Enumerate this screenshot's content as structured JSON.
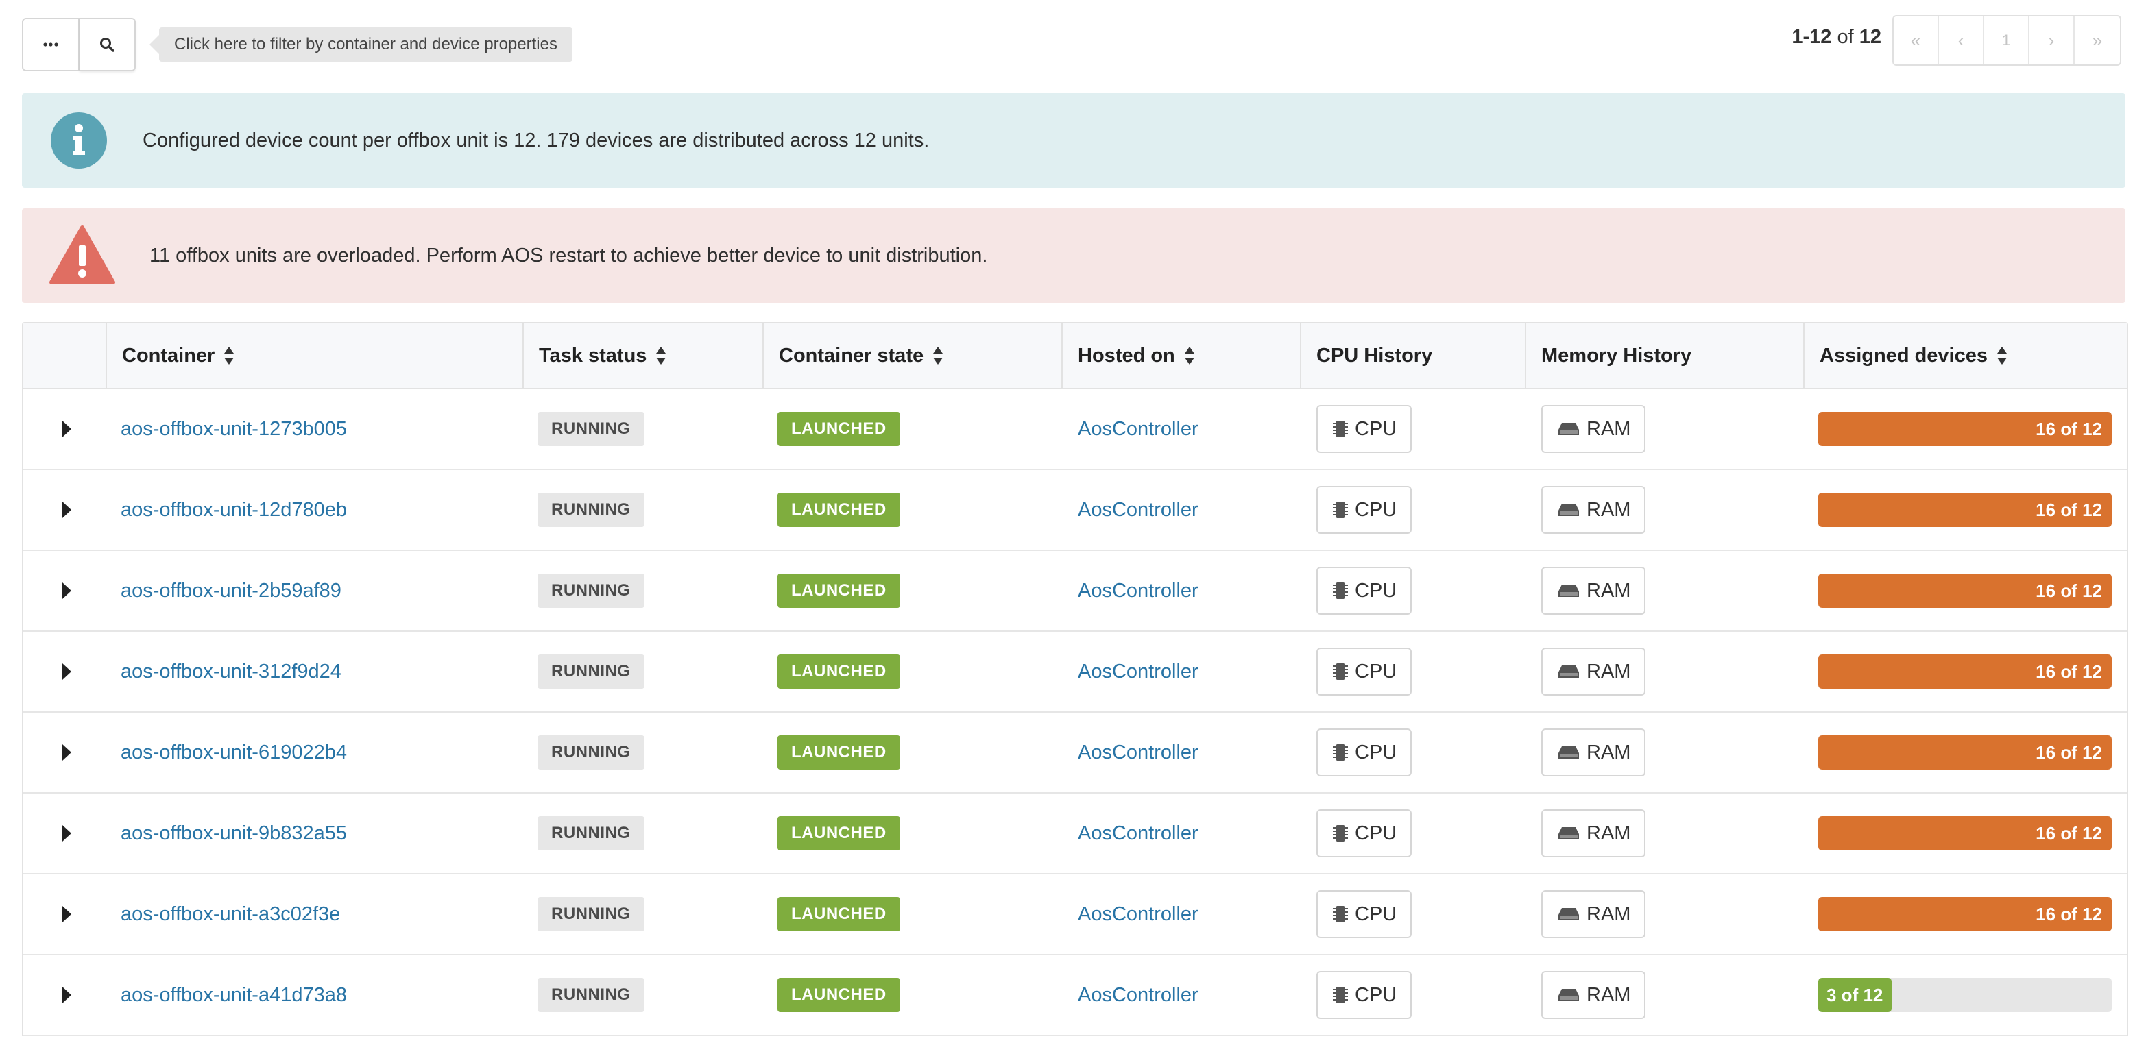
{
  "toolbar": {
    "more_icon": "ellipsis-icon",
    "search_icon": "search-icon",
    "filter_hint": "Click here to filter by container and device properties"
  },
  "pagination": {
    "range": "1-12",
    "of_label": "of",
    "total": "12",
    "current_page": "1",
    "first_glyph": "«",
    "prev_glyph": "‹",
    "next_glyph": "›",
    "last_glyph": "»"
  },
  "alerts": {
    "info": "Configured device count per offbox unit is 12. 179 devices are distributed across 12 units.",
    "warning": "11 offbox units are overloaded. Perform AOS restart to achieve better device to unit distribution."
  },
  "colors": {
    "info_bg": "#e0eff1",
    "info_icon": "#5ba4b5",
    "warning_bg": "#f6e6e5",
    "warning_icon": "#e06e62",
    "overloaded": "#d9722e",
    "normal": "#7fad3e",
    "link": "#2874a6"
  },
  "table": {
    "columns": {
      "container": "Container",
      "task_status": "Task status",
      "container_state": "Container state",
      "hosted_on": "Hosted on",
      "cpu_history": "CPU History",
      "memory_history": "Memory History",
      "assigned_devices": "Assigned devices"
    },
    "cpu_label": "CPU",
    "ram_label": "RAM",
    "rows": [
      {
        "container": "aos-offbox-unit-1273b005",
        "task_status": "RUNNING",
        "container_state": "LAUNCHED",
        "hosted_on": "AosController",
        "assigned": "16 of 12",
        "assigned_value": 16,
        "capacity": 12
      },
      {
        "container": "aos-offbox-unit-12d780eb",
        "task_status": "RUNNING",
        "container_state": "LAUNCHED",
        "hosted_on": "AosController",
        "assigned": "16 of 12",
        "assigned_value": 16,
        "capacity": 12
      },
      {
        "container": "aos-offbox-unit-2b59af89",
        "task_status": "RUNNING",
        "container_state": "LAUNCHED",
        "hosted_on": "AosController",
        "assigned": "16 of 12",
        "assigned_value": 16,
        "capacity": 12
      },
      {
        "container": "aos-offbox-unit-312f9d24",
        "task_status": "RUNNING",
        "container_state": "LAUNCHED",
        "hosted_on": "AosController",
        "assigned": "16 of 12",
        "assigned_value": 16,
        "capacity": 12
      },
      {
        "container": "aos-offbox-unit-619022b4",
        "task_status": "RUNNING",
        "container_state": "LAUNCHED",
        "hosted_on": "AosController",
        "assigned": "16 of 12",
        "assigned_value": 16,
        "capacity": 12
      },
      {
        "container": "aos-offbox-unit-9b832a55",
        "task_status": "RUNNING",
        "container_state": "LAUNCHED",
        "hosted_on": "AosController",
        "assigned": "16 of 12",
        "assigned_value": 16,
        "capacity": 12
      },
      {
        "container": "aos-offbox-unit-a3c02f3e",
        "task_status": "RUNNING",
        "container_state": "LAUNCHED",
        "hosted_on": "AosController",
        "assigned": "16 of 12",
        "assigned_value": 16,
        "capacity": 12
      },
      {
        "container": "aos-offbox-unit-a41d73a8",
        "task_status": "RUNNING",
        "container_state": "LAUNCHED",
        "hosted_on": "AosController",
        "assigned": "3 of 12",
        "assigned_value": 3,
        "capacity": 12
      }
    ]
  }
}
